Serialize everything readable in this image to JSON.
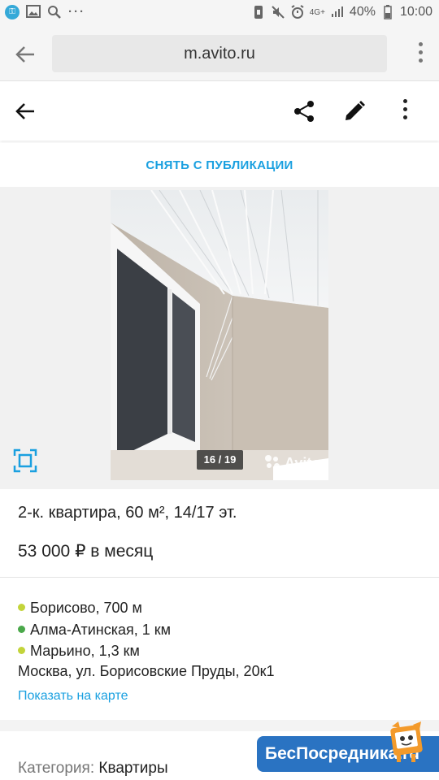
{
  "status_bar": {
    "battery": "40%",
    "time": "10:00",
    "network": "4G+"
  },
  "browser": {
    "url": "m.avito.ru"
  },
  "actions": {
    "unpublish_label": "СНЯТЬ С ПУБЛИКАЦИИ"
  },
  "gallery": {
    "counter": "16 / 19",
    "watermark": "Avito"
  },
  "listing": {
    "title": "2-к. квартира, 60 м², 14/17 эт.",
    "price": "53 000 ₽ в месяц",
    "metro": [
      {
        "name": "Борисово, 700 м",
        "color": "#c3d43a"
      },
      {
        "name": "Алма-Атинская, 1 км",
        "color": "#4aa84a"
      },
      {
        "name": "Марьино, 1,3 км",
        "color": "#c3d43a"
      }
    ],
    "address": "Москва, ул. Борисовские Пруды, 20к1",
    "map_link": "Показать на карте",
    "category_label": "Категория:",
    "category_value": "Квартиры"
  },
  "overlay": {
    "brand": "БесПосредника.ru"
  },
  "colors": {
    "accent": "#1aa0e0",
    "badge": "#2a73c2"
  }
}
